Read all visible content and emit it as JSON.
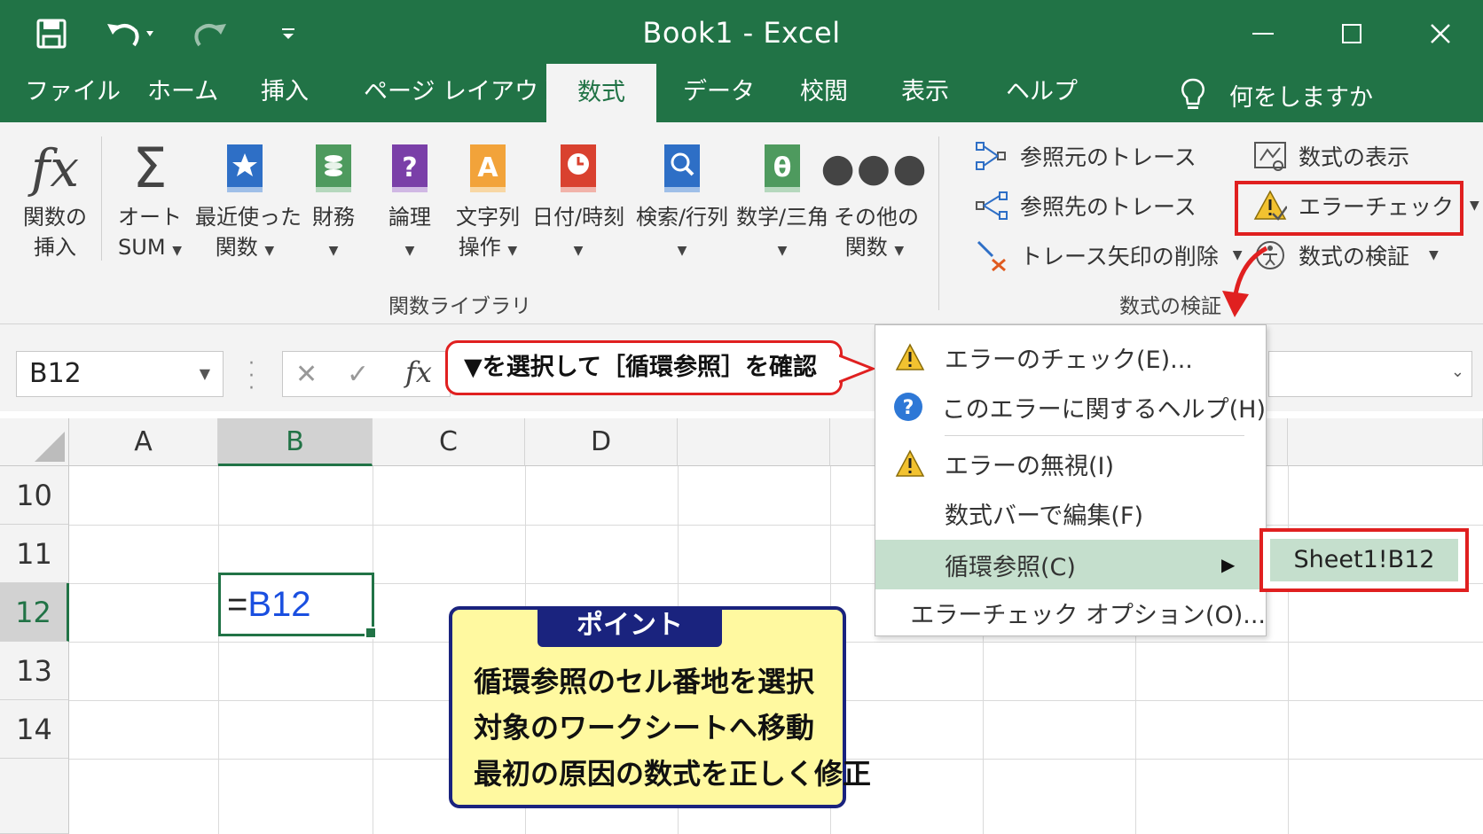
{
  "window": {
    "title": "Book1  -  Excel"
  },
  "tabs": [
    {
      "label": "ファイル"
    },
    {
      "label": "ホーム"
    },
    {
      "label": "挿入"
    },
    {
      "label": "ページ レイアウト"
    },
    {
      "label": "数式"
    },
    {
      "label": "データ"
    },
    {
      "label": "校閲"
    },
    {
      "label": "表示"
    },
    {
      "label": "ヘルプ"
    }
  ],
  "tell_me": "何をしますか",
  "ribbon": {
    "library_group": "関数ライブラリ",
    "audit_group": "数式の検証",
    "buttons": [
      {
        "line1": "関数の",
        "line2": "挿入"
      },
      {
        "line1": "オート",
        "line2": "SUM"
      },
      {
        "line1": "最近使った",
        "line2": "関数"
      },
      {
        "line1": "財務",
        "line2": ""
      },
      {
        "line1": "論理",
        "line2": ""
      },
      {
        "line1": "文字列",
        "line2": "操作"
      },
      {
        "line1": "日付/時刻",
        "line2": ""
      },
      {
        "line1": "検索/行列",
        "line2": ""
      },
      {
        "line1": "数学/三角",
        "line2": ""
      },
      {
        "line1": "その他の",
        "line2": "関数"
      }
    ],
    "trace_precedents": "参照元のトレース",
    "trace_dependents": "参照先のトレース",
    "remove_arrows": "トレース矢印の削除",
    "show_formulas": "数式の表示",
    "error_check": "エラーチェック",
    "evaluate_formula": "数式の検証"
  },
  "formula_bar": {
    "name_box": "B12",
    "fx": "fx"
  },
  "grid": {
    "columns": [
      "A",
      "B",
      "C",
      "D"
    ],
    "rows": [
      "10",
      "11",
      "12",
      "13",
      "14"
    ],
    "active_cell_formula_eq": "=",
    "active_cell_formula_ref": "B12"
  },
  "callout": "▼を選択して［循環参照］を確認",
  "point": {
    "title": "ポイント",
    "lines": [
      "循環参照のセル番地を選択",
      "対象のワークシートへ移動",
      "最初の原因の数式を正しく修正"
    ]
  },
  "menu": {
    "items": [
      {
        "label": "エラーのチェック(E)..."
      },
      {
        "label": "このエラーに関するヘルプ(H)"
      },
      {
        "label": "エラーの無視(I)"
      },
      {
        "label": "数式バーで編集(F)"
      },
      {
        "label": "循環参照(C)"
      },
      {
        "label": "エラーチェック オプション(O)..."
      }
    ],
    "submenu_item": "Sheet1!B12"
  },
  "colors": {
    "excel_green": "#217346",
    "highlight_red": "#e02020",
    "point_navy": "#1a237e",
    "point_yellow": "#fff9a0",
    "menu_highlight": "#c5dfcd"
  }
}
